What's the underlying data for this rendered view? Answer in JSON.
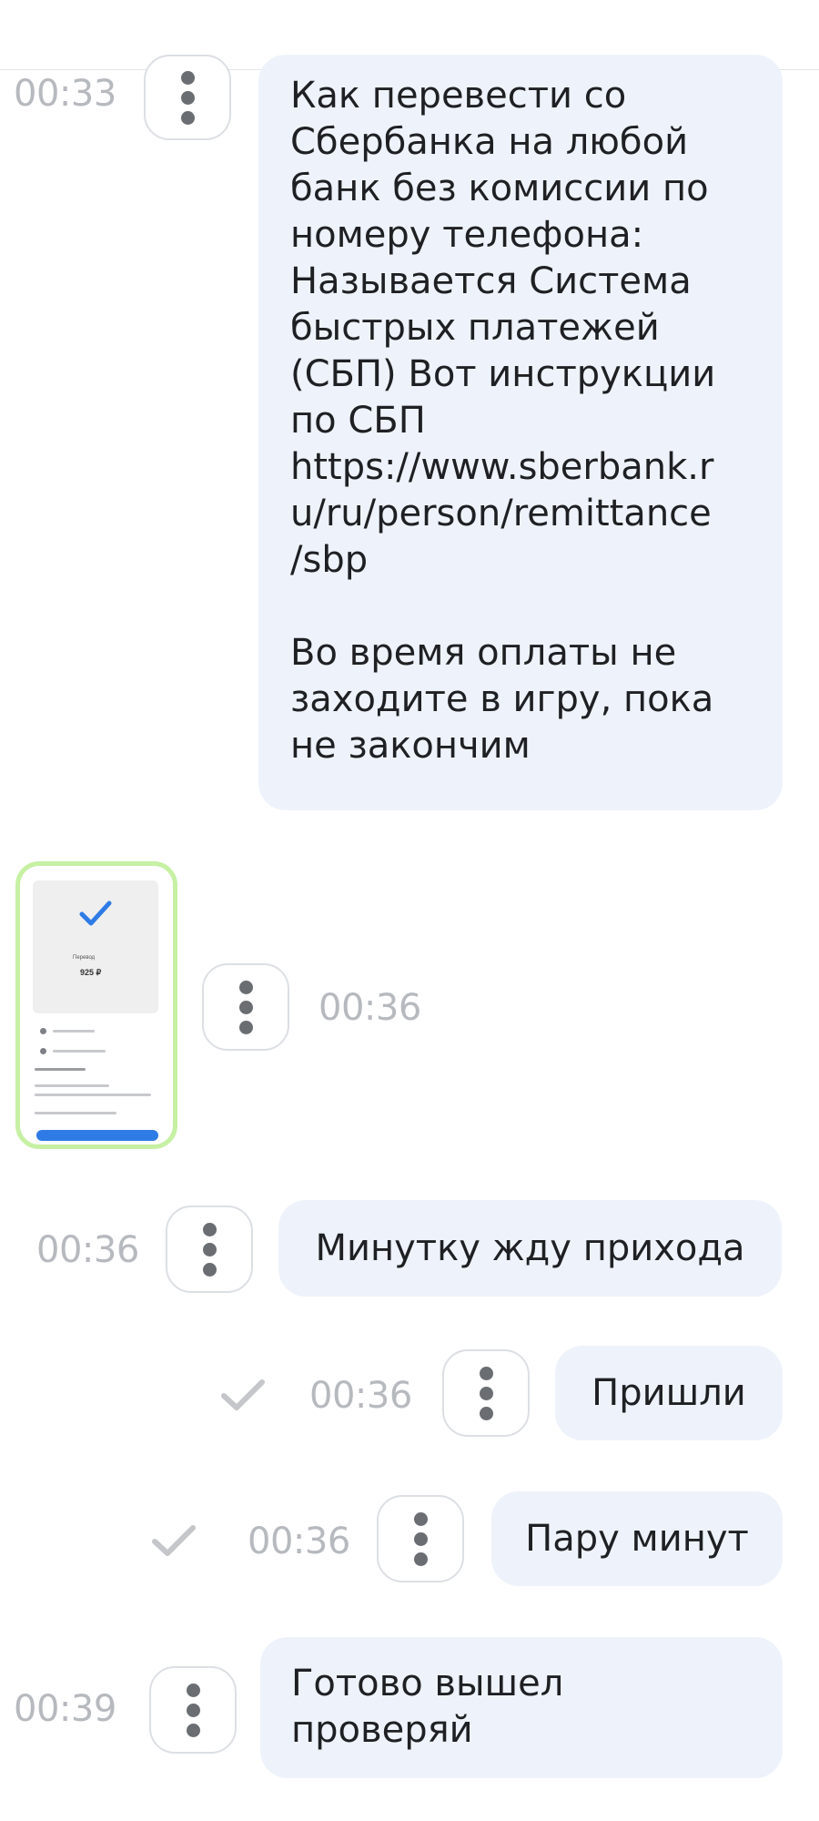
{
  "messages": [
    {
      "time": "00:33",
      "text": "Как перевести со\nСбербанка на любой\nбанк без комиссии по\nномеру телефона:\nНазывается Система\nбыстрых платежей\n(СБП) Вот инструкции\nпо СБП\nhttps://www.sberbank.r\nu/ru/person/remittance\n/sbp\n\nВо время оплаты не\nзаходите в игру, пока\nне закончим"
    },
    {
      "time": "00:36",
      "image": {
        "label": "Перевод",
        "amount": "925 ₽"
      }
    },
    {
      "time": "00:36",
      "text": "Минутку жду прихода"
    },
    {
      "time": "00:36",
      "text": "Пришли",
      "status": "sent"
    },
    {
      "time": "00:36",
      "text": "Пару минут",
      "status": "sent"
    },
    {
      "time": "00:39",
      "text": "Готово вышел\nпроверяй"
    }
  ],
  "icons": {
    "more": "more-vertical-icon",
    "sent": "check-icon"
  },
  "colors": {
    "bubble": "#eef3fb",
    "time": "#b6b9be",
    "thumbnail_border": "#c6f0a3",
    "check": "#c4c6ca"
  }
}
